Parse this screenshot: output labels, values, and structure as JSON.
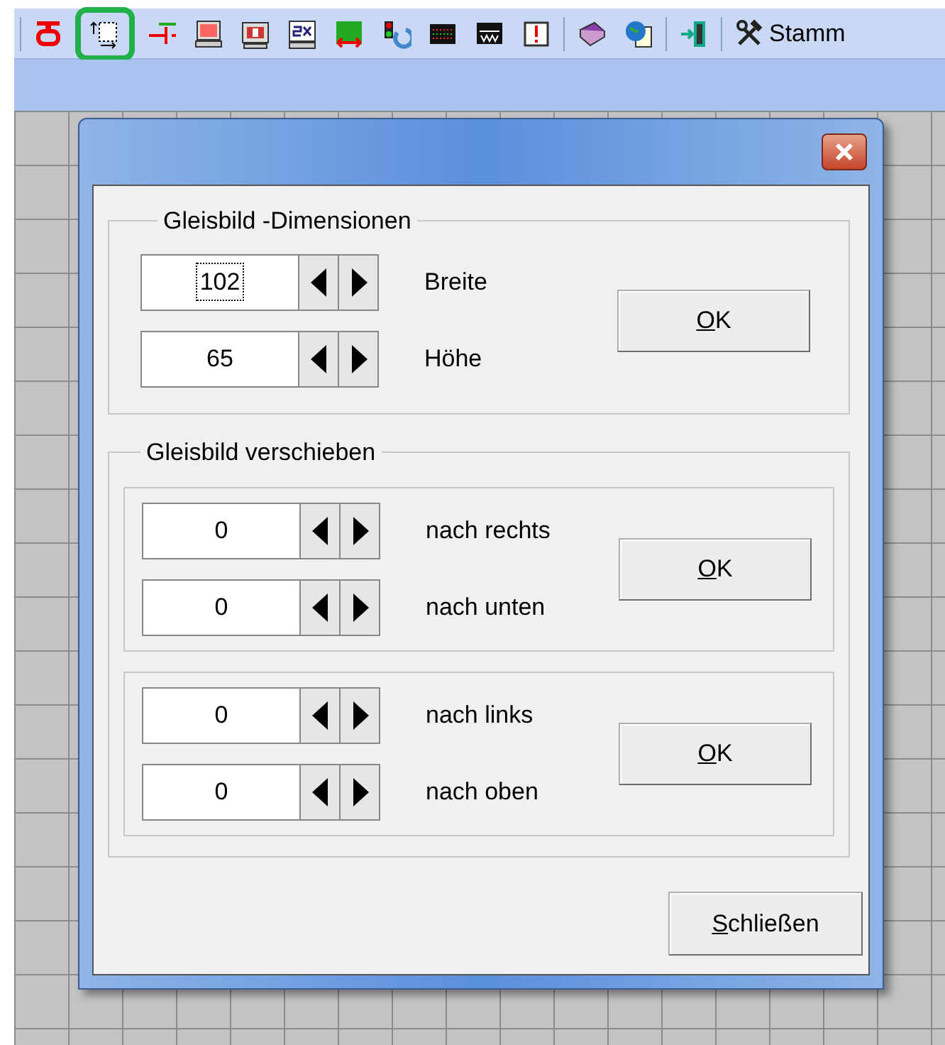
{
  "toolbar": {
    "buttons": [
      {
        "highlighted": false
      },
      {
        "highlighted": true
      },
      {
        "highlighted": false
      },
      {
        "highlighted": false
      },
      {
        "highlighted": false
      },
      {
        "highlighted": false
      },
      {
        "highlighted": false
      },
      {
        "highlighted": false
      },
      {
        "highlighted": false
      },
      {
        "highlighted": false
      },
      {
        "highlighted": false
      },
      {
        "highlighted": false
      },
      {
        "highlighted": false
      },
      {
        "highlighted": false
      },
      {
        "highlighted": false,
        "label": "Stamm"
      }
    ]
  },
  "dialog": {
    "dimensions": {
      "title": "Gleisbild -Dimensionen",
      "fields": [
        {
          "value": "102",
          "label": "Breite",
          "focused": true
        },
        {
          "value": "65",
          "label": "Höhe",
          "focused": false
        }
      ],
      "ok": {
        "label": "OK",
        "mnemonic": true
      }
    },
    "shift": {
      "title": "Gleisbild verschieben",
      "groups": [
        {
          "fields": [
            {
              "value": "0",
              "label": "nach rechts",
              "focused": false
            },
            {
              "value": "0",
              "label": "nach unten",
              "focused": false
            }
          ],
          "ok": {
            "label": "OK",
            "mnemonic": true
          }
        },
        {
          "fields": [
            {
              "value": "0",
              "label": "nach links",
              "focused": false
            },
            {
              "value": "0",
              "label": "nach oben",
              "focused": false
            }
          ],
          "ok": {
            "label": "OK",
            "mnemonic": true
          }
        }
      ]
    },
    "close": {
      "label": "Schließen",
      "mnemonic": true
    }
  }
}
